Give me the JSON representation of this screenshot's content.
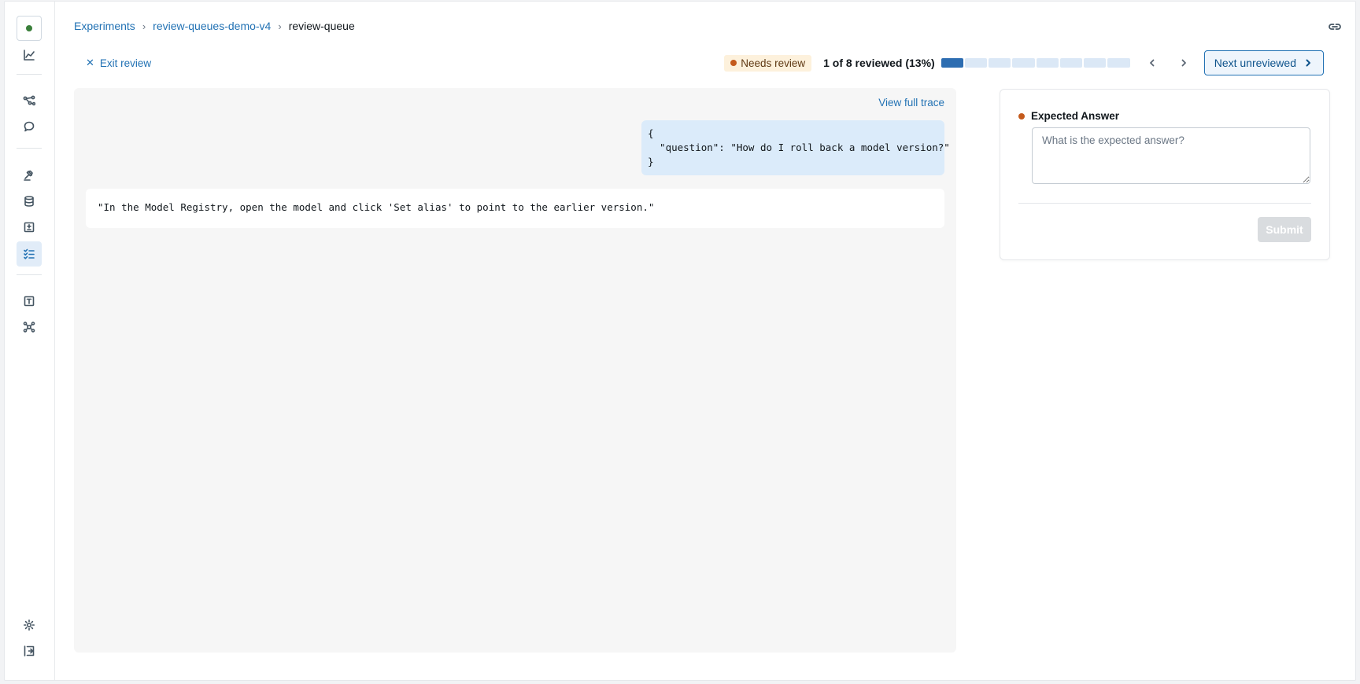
{
  "breadcrumb": {
    "items": [
      "Experiments",
      "review-queues-demo-v4"
    ],
    "current": "review-queue"
  },
  "review": {
    "exit_label": "Exit review",
    "status_badge": "Needs review",
    "progress_text": "1 of 8 reviewed (13%)",
    "progress": {
      "reviewed": 1,
      "total": 8
    },
    "next_label": "Next unreviewed"
  },
  "trace": {
    "view_full_trace": "View full trace",
    "request": "{\n  \"question\": \"How do I roll back a model version?\"\n}",
    "response": "\"In the Model Registry, open the model and click 'Set alias' to point to the earlier version.\""
  },
  "assessment": {
    "field_label": "Expected Answer",
    "placeholder": "What is the expected answer?",
    "value": "",
    "submit_label": "Submit"
  },
  "colors": {
    "accent": "#2272b4",
    "status_dot": "#c45a1c",
    "badge_bg": "#fdf1dc",
    "progress_done": "#2d6db1",
    "progress_todo": "#dbe8f6"
  },
  "sidebar_icons": [
    "workspace-status-icon",
    "chart-line-icon",
    "nodes-icon",
    "chat-icon",
    "gavel-icon",
    "database-icon",
    "plus-minus-icon",
    "checklist-icon",
    "text-box-icon",
    "model-icon",
    "gear-icon",
    "collapse-sidebar-icon"
  ]
}
